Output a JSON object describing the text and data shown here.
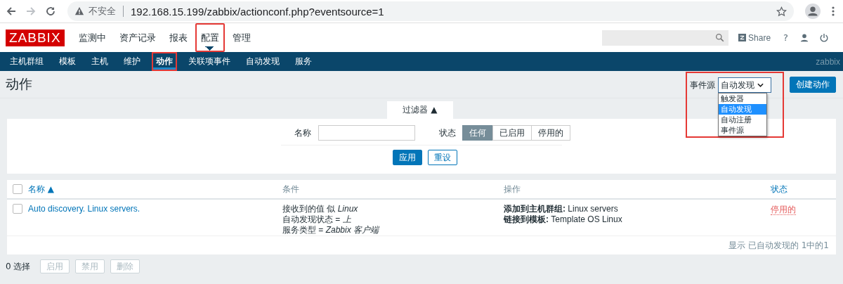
{
  "browser": {
    "security_label": "不安全",
    "url": "192.168.15.199/zabbix/actionconf.php?eventsource=1"
  },
  "header": {
    "logo": "ZABBIX",
    "menu": [
      {
        "label": "监测中",
        "selected": false,
        "annotated": false
      },
      {
        "label": "资产记录",
        "selected": false,
        "annotated": false
      },
      {
        "label": "报表",
        "selected": false,
        "annotated": false
      },
      {
        "label": "配置",
        "selected": true,
        "annotated": true
      },
      {
        "label": "管理",
        "selected": false,
        "annotated": false
      }
    ],
    "share": "Share",
    "help": "?"
  },
  "subnav": {
    "items": [
      {
        "label": "主机群组",
        "selected": false,
        "annotated": false
      },
      {
        "label": "模板",
        "selected": false,
        "annotated": false
      },
      {
        "label": "主机",
        "selected": false,
        "annotated": false
      },
      {
        "label": "维护",
        "selected": false,
        "annotated": false
      },
      {
        "label": "动作",
        "selected": true,
        "annotated": true
      },
      {
        "label": "关联项事件",
        "selected": false,
        "annotated": false
      },
      {
        "label": "自动发现",
        "selected": false,
        "annotated": false
      },
      {
        "label": "服务",
        "selected": false,
        "annotated": false
      }
    ],
    "server_name": "zabbix"
  },
  "page": {
    "title": "动作",
    "event_source": {
      "label": "事件源",
      "value": "自动发现",
      "expanded": true,
      "annotated": true,
      "options": [
        {
          "label": "触发器",
          "selected": false
        },
        {
          "label": "自动发现",
          "selected": true
        },
        {
          "label": "自动注册",
          "selected": false
        },
        {
          "label": "事件源",
          "selected": false
        }
      ]
    },
    "create_button": "创建动作"
  },
  "filter": {
    "tab": "过滤器 ▲",
    "name_label": "名称",
    "status_label": "状态",
    "status_options": [
      {
        "label": "任何",
        "selected": true
      },
      {
        "label": "已启用",
        "selected": false
      },
      {
        "label": "停用的",
        "selected": false
      }
    ],
    "apply": "应用",
    "reset": "重设"
  },
  "table": {
    "all_checked": false,
    "columns": [
      {
        "label": "名称 ▲",
        "sortable": true
      },
      {
        "label": "条件",
        "sortable": false
      },
      {
        "label": "操作",
        "sortable": false
      },
      {
        "label": "状态",
        "sortable": true
      }
    ],
    "rows": [
      {
        "checked": false,
        "name": "Auto discovery. Linux servers.",
        "conditions": [
          "接收到的值 似 *Linux*",
          "自动发现状态 = *上*",
          "服务类型 = *Zabbix 客户端*"
        ],
        "operations": [
          "**添加到主机群组:** Linux servers",
          "**链接到模板:** Template OS Linux"
        ],
        "status": "停用的",
        "enabled": false
      }
    ],
    "footer": "显示 已自动发现的 1中的1"
  },
  "actions": {
    "selected_count": "0 选择",
    "buttons": [
      "启用",
      "禁用",
      "删除"
    ]
  }
}
